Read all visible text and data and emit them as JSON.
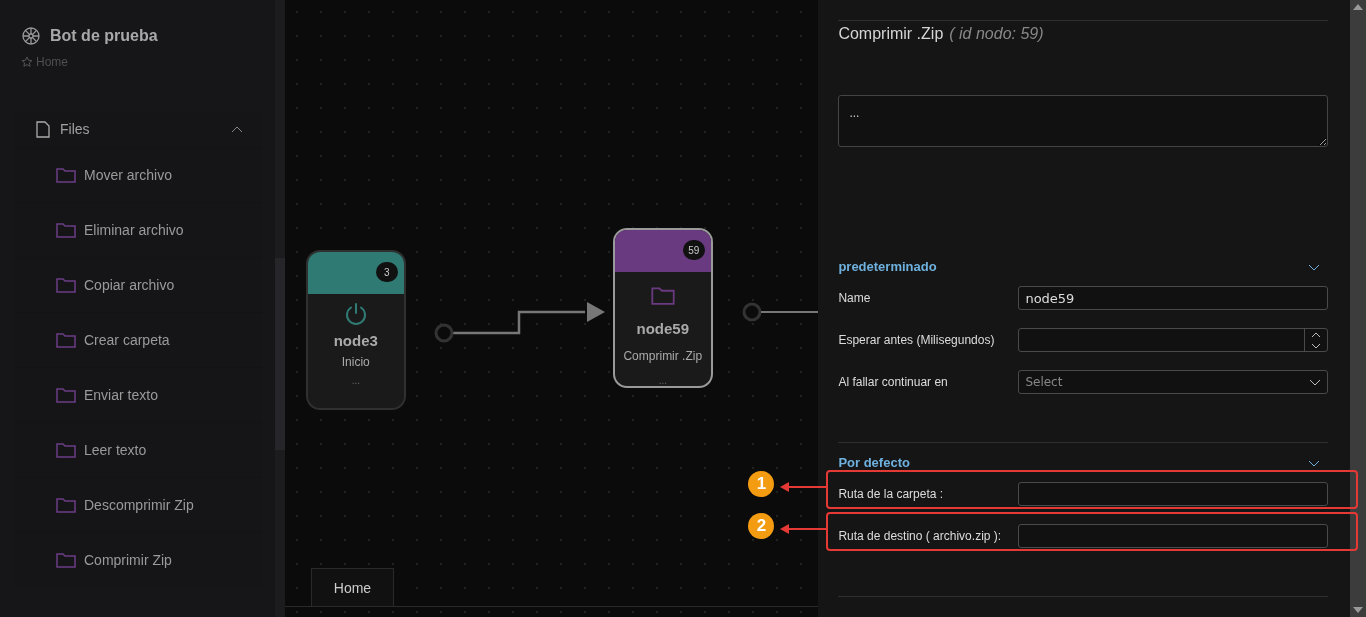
{
  "sidebar": {
    "title": "Bot de prueba",
    "breadcrumb": "Home",
    "group": {
      "label": "Files",
      "expanded": true,
      "items": [
        {
          "label": "Mover archivo"
        },
        {
          "label": "Eliminar archivo"
        },
        {
          "label": "Copiar archivo"
        },
        {
          "label": "Crear carpeta"
        },
        {
          "label": "Enviar texto"
        },
        {
          "label": "Leer texto"
        },
        {
          "label": "Descomprimir Zip"
        },
        {
          "label": "Comprimir Zip"
        }
      ]
    }
  },
  "canvas": {
    "nodes": [
      {
        "badge": "3",
        "name": "node3",
        "subtitle": "Inicio",
        "description": "...",
        "kind": "start",
        "color": "#2f7a73",
        "selected": false
      },
      {
        "badge": "59",
        "name": "node59",
        "subtitle": "Comprimir .Zip",
        "description": "...",
        "kind": "folder",
        "color": "#6a3a80",
        "selected": true
      }
    ],
    "tabs": [
      {
        "label": "Home",
        "selected": true
      }
    ]
  },
  "panel": {
    "title": "Comprimir .Zip",
    "subtitle": "( id nodo: 59)",
    "description": "...",
    "sections": [
      {
        "title": "predeterminado",
        "expanded": true,
        "fields": [
          {
            "label": "Name",
            "kind": "text",
            "value": "node59"
          },
          {
            "label": "Esperar antes (Milisegundos)",
            "kind": "number"
          },
          {
            "label": "Al fallar continuar en",
            "kind": "select",
            "placeholder": "Select"
          }
        ]
      },
      {
        "title": "Por defecto",
        "expanded": true,
        "fields": [
          {
            "label": "Ruta de la carpeta :",
            "kind": "text",
            "callout": "1"
          },
          {
            "label": "Ruta de destino ( archivo.zip ):",
            "kind": "text",
            "callout": "2"
          }
        ]
      }
    ]
  }
}
